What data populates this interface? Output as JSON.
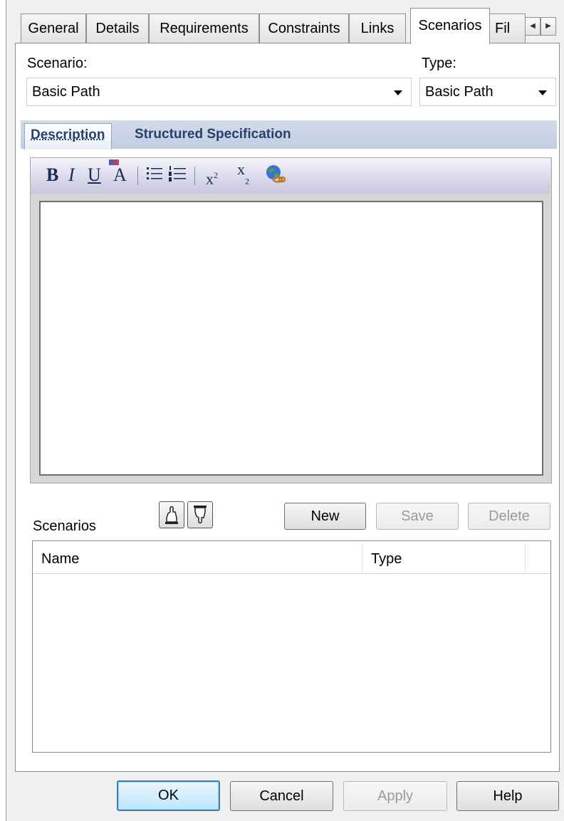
{
  "tabs": [
    "General",
    "Details",
    "Requirements",
    "Constraints",
    "Links",
    "Scenarios",
    "Fil"
  ],
  "active_tab": "Scenarios",
  "scenario": {
    "label": "Scenario:",
    "value": "Basic Path"
  },
  "type": {
    "label": "Type:",
    "value": "Basic Path"
  },
  "subtabs": [
    "Description",
    "Structured Specification"
  ],
  "toolbar": {
    "bold": "B",
    "italic": "I",
    "underline": "U",
    "color": "A",
    "superscript": "x",
    "superscript_mark": "2",
    "subscript": "x",
    "subscript_mark": "2"
  },
  "scenarios_section": {
    "label": "Scenarios",
    "new_label": "New",
    "save_label": "Save",
    "delete_label": "Delete"
  },
  "list_columns": [
    "Name",
    "Type"
  ],
  "footer": {
    "ok": "OK",
    "cancel": "Cancel",
    "apply": "Apply",
    "help": "Help"
  }
}
